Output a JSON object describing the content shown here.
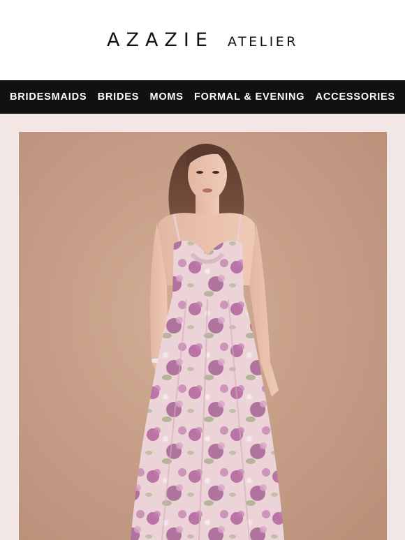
{
  "brand": {
    "name": "AZAZIE",
    "sub": "ATELIER"
  },
  "nav": {
    "items": [
      {
        "label": "BRIDESMAIDS"
      },
      {
        "label": "BRIDES"
      },
      {
        "label": "MOMS"
      },
      {
        "label": "FORMAL & EVENING"
      },
      {
        "label": "ACCESSORIES"
      }
    ]
  },
  "colors": {
    "nav_bg": "#111111",
    "hero_frame": "#f3e7e6",
    "hero_backdrop": "#c8a28b",
    "dress_base": "#e9cdd4",
    "floral": "#9b4a86"
  }
}
